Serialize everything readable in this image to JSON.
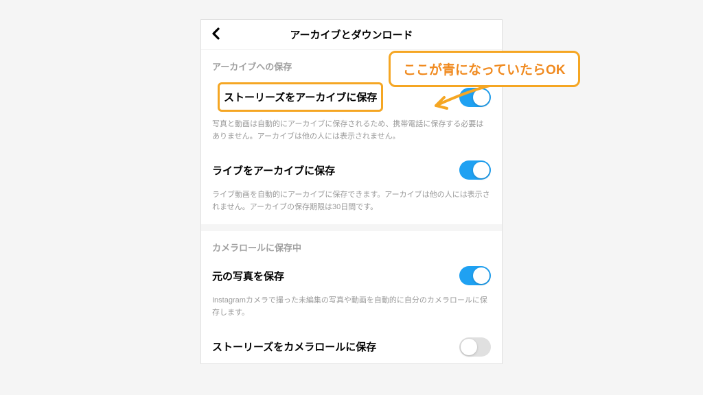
{
  "header": {
    "title": "アーカイブとダウンロード"
  },
  "callout": {
    "text": "ここが青になっていたらOK"
  },
  "section1": {
    "header": "アーカイブへの保存",
    "item1": {
      "label": "ストーリーズをアーカイブに保存",
      "desc": "写真と動画は自動的にアーカイブに保存されるため、携帯電話に保存する必要はありません。アーカイブは他の人には表示されません。"
    },
    "item2": {
      "label": "ライブをアーカイブに保存",
      "desc": "ライブ動画を自動的にアーカイブに保存できます。アーカイブは他の人には表示されません。アーカイブの保存期限は30日間です。"
    }
  },
  "section2": {
    "header": "カメラロールに保存中",
    "item1": {
      "label": "元の写真を保存",
      "desc": "Instagramカメラで撮った未編集の写真や動画を自動的に自分のカメラロールに保存します。"
    },
    "item2": {
      "label": "ストーリーズをカメラロールに保存"
    }
  }
}
